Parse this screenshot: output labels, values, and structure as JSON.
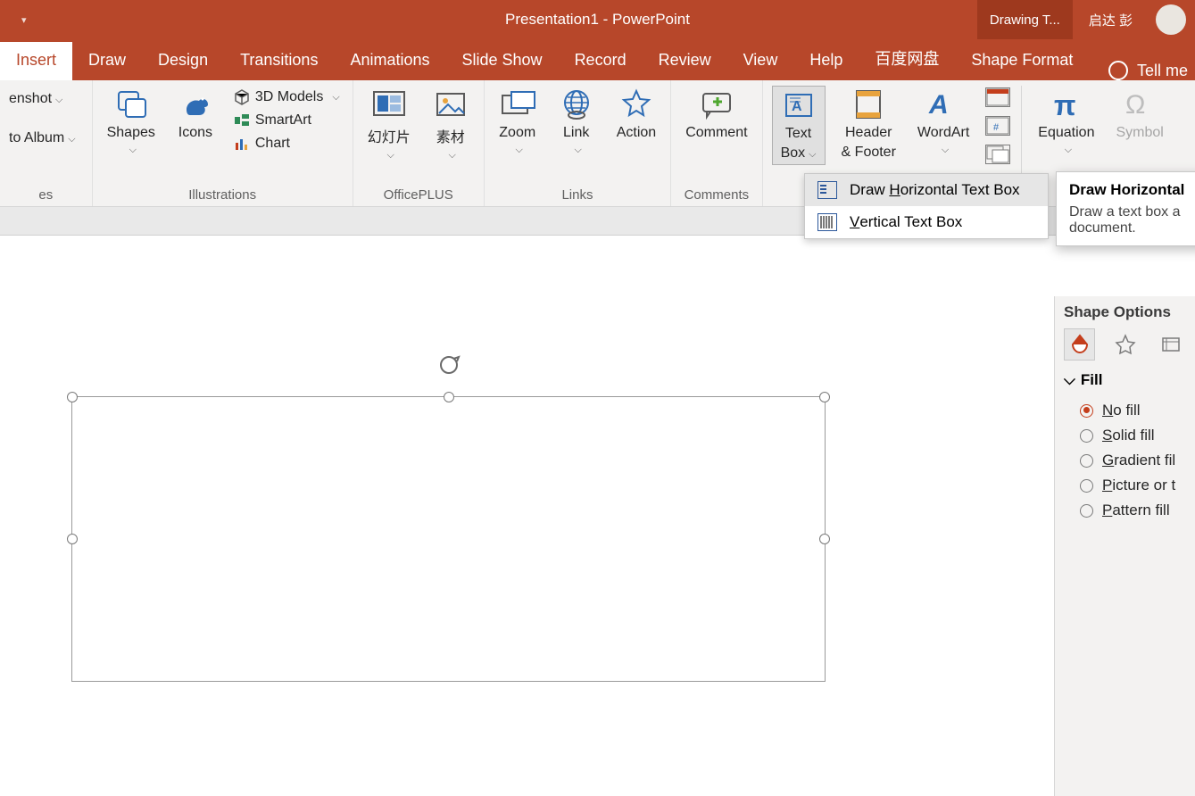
{
  "titlebar": {
    "title": "Presentation1  -  PowerPoint",
    "drawing_tools": "Drawing T...",
    "user_name": "启达 彭"
  },
  "tabs": {
    "insert": "Insert",
    "draw": "Draw",
    "design": "Design",
    "transitions": "Transitions",
    "animations": "Animations",
    "slideshow": "Slide Show",
    "record": "Record",
    "review": "Review",
    "view": "View",
    "help": "Help",
    "baidu": "百度网盘",
    "shape_format": "Shape Format",
    "tellme": "Tell me"
  },
  "ribbon": {
    "partial": {
      "screenshot": "enshot",
      "to_album": "to Album",
      "group_label": "es"
    },
    "illustrations": {
      "label": "Illustrations",
      "shapes": "Shapes",
      "icons": "Icons",
      "models_3d": "3D Models",
      "smartart": "SmartArt",
      "chart": "Chart"
    },
    "officeplus": {
      "label": "OfficePLUS",
      "slides": "幻灯片",
      "materials": "素材"
    },
    "links": {
      "label": "Links",
      "zoom": "Zoom",
      "link": "Link",
      "action": "Action"
    },
    "comments": {
      "label": "Comments",
      "comment": "Comment"
    },
    "text_group": {
      "textbox_l1": "Text",
      "textbox_l2": "Box",
      "header_l1": "Header",
      "header_l2": "& Footer",
      "wordart": "WordArt"
    },
    "symbols": {
      "equation": "Equation",
      "symbol": "Symbol"
    }
  },
  "dropdown": {
    "horizontal": "Draw Horizontal Text Box",
    "vertical": "Vertical Text Box",
    "h_underline": "H",
    "v_underline": "V"
  },
  "tooltip": {
    "title": "Draw Horizontal",
    "body_l1": "Draw a text box a",
    "body_l2": "document."
  },
  "pane": {
    "head": "Shape Options",
    "fill_label": "Fill",
    "no_fill": "No fill",
    "solid_fill": "Solid fill",
    "gradient_fill": "Gradient fil",
    "picture_fill": "Picture or t",
    "pattern_fill": "Pattern fill",
    "u": {
      "n": "N",
      "s": "S",
      "g": "G",
      "p": "P",
      "pa": "P"
    }
  }
}
